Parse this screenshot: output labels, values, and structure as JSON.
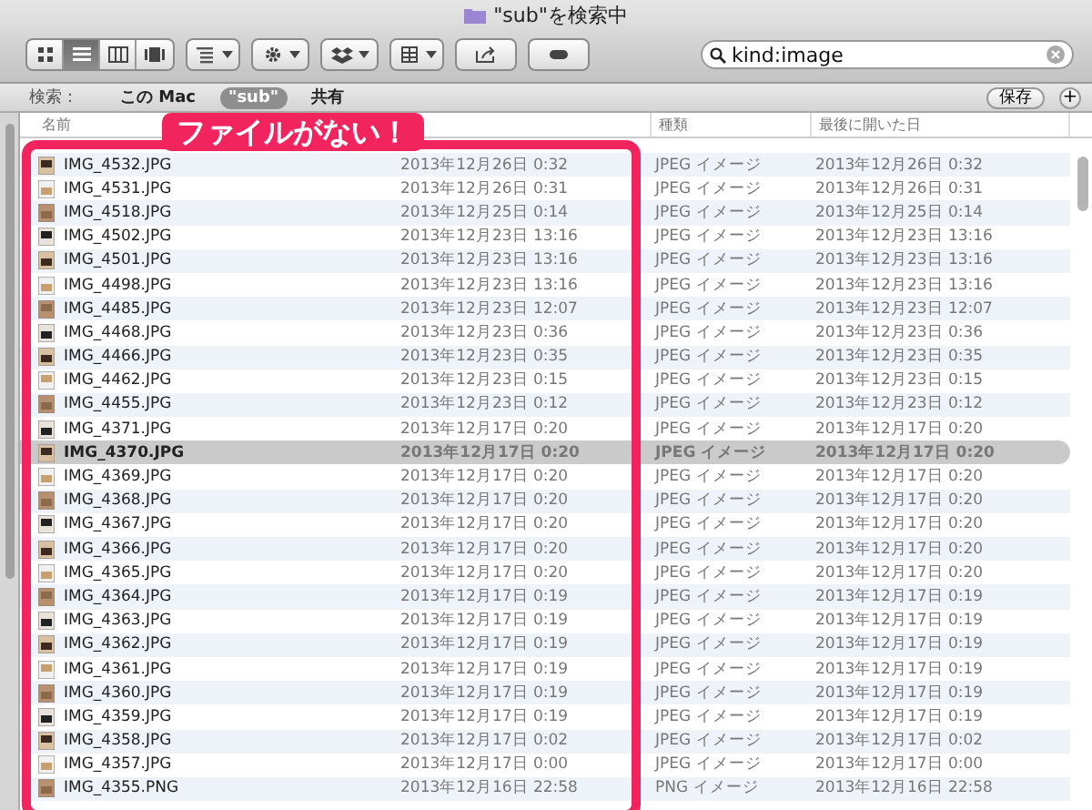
{
  "window": {
    "title": "\"sub\"を検索中"
  },
  "toolbar": {
    "view_modes": [
      {
        "kind": "icons",
        "selected": false
      },
      {
        "kind": "list",
        "selected": true
      },
      {
        "kind": "columns",
        "selected": false
      },
      {
        "kind": "coverflow",
        "selected": false
      }
    ],
    "buttons": [
      {
        "kind": "arrange"
      },
      {
        "kind": "action"
      },
      {
        "kind": "dropbox"
      },
      {
        "kind": "group"
      },
      {
        "kind": "share"
      },
      {
        "kind": "tag"
      }
    ]
  },
  "search": {
    "value": "kind:image"
  },
  "scope_bar": {
    "label": "検索：",
    "scopes": [
      {
        "label": "この Mac",
        "selected": false
      },
      {
        "label": "\"sub\"",
        "selected": true
      },
      {
        "label": "共有",
        "selected": false
      }
    ],
    "save": "保存",
    "add": "+"
  },
  "table": {
    "columns": [
      {
        "label": "名前"
      },
      {
        "label": "種類"
      },
      {
        "label": "最後に開いた日"
      }
    ],
    "rows": [
      {
        "name": "IMG_4532.JPG",
        "date": "2013年12月26日 0:32",
        "kind": "JPEG イメージ",
        "opened": "2013年12月26日 0:32",
        "selected": false
      },
      {
        "name": "IMG_4531.JPG",
        "date": "2013年12月26日 0:31",
        "kind": "JPEG イメージ",
        "opened": "2013年12月26日 0:31",
        "selected": false
      },
      {
        "name": "IMG_4518.JPG",
        "date": "2013年12月25日 0:14",
        "kind": "JPEG イメージ",
        "opened": "2013年12月25日 0:14",
        "selected": false
      },
      {
        "name": "IMG_4502.JPG",
        "date": "2013年12月23日 13:16",
        "kind": "JPEG イメージ",
        "opened": "2013年12月23日 13:16",
        "selected": false
      },
      {
        "name": "IMG_4501.JPG",
        "date": "2013年12月23日 13:16",
        "kind": "JPEG イメージ",
        "opened": "2013年12月23日 13:16",
        "selected": false
      },
      {
        "name": "IMG_4498.JPG",
        "date": "2013年12月23日 13:16",
        "kind": "JPEG イメージ",
        "opened": "2013年12月23日 13:16",
        "selected": false
      },
      {
        "name": "IMG_4485.JPG",
        "date": "2013年12月23日 12:07",
        "kind": "JPEG イメージ",
        "opened": "2013年12月23日 12:07",
        "selected": false
      },
      {
        "name": "IMG_4468.JPG",
        "date": "2013年12月23日 0:36",
        "kind": "JPEG イメージ",
        "opened": "2013年12月23日 0:36",
        "selected": false
      },
      {
        "name": "IMG_4466.JPG",
        "date": "2013年12月23日 0:35",
        "kind": "JPEG イメージ",
        "opened": "2013年12月23日 0:35",
        "selected": false
      },
      {
        "name": "IMG_4462.JPG",
        "date": "2013年12月23日 0:15",
        "kind": "JPEG イメージ",
        "opened": "2013年12月23日 0:15",
        "selected": false
      },
      {
        "name": "IMG_4455.JPG",
        "date": "2013年12月23日 0:12",
        "kind": "JPEG イメージ",
        "opened": "2013年12月23日 0:12",
        "selected": false
      },
      {
        "name": "IMG_4371.JPG",
        "date": "2013年12月17日 0:20",
        "kind": "JPEG イメージ",
        "opened": "2013年12月17日 0:20",
        "selected": false
      },
      {
        "name": "IMG_4370.JPG",
        "date": "2013年12月17日 0:20",
        "kind": "JPEG イメージ",
        "opened": "2013年12月17日 0:20",
        "selected": true
      },
      {
        "name": "IMG_4369.JPG",
        "date": "2013年12月17日 0:20",
        "kind": "JPEG イメージ",
        "opened": "2013年12月17日 0:20",
        "selected": false
      },
      {
        "name": "IMG_4368.JPG",
        "date": "2013年12月17日 0:20",
        "kind": "JPEG イメージ",
        "opened": "2013年12月17日 0:20",
        "selected": false
      },
      {
        "name": "IMG_4367.JPG",
        "date": "2013年12月17日 0:20",
        "kind": "JPEG イメージ",
        "opened": "2013年12月17日 0:20",
        "selected": false
      },
      {
        "name": "IMG_4366.JPG",
        "date": "2013年12月17日 0:20",
        "kind": "JPEG イメージ",
        "opened": "2013年12月17日 0:20",
        "selected": false
      },
      {
        "name": "IMG_4365.JPG",
        "date": "2013年12月17日 0:20",
        "kind": "JPEG イメージ",
        "opened": "2013年12月17日 0:20",
        "selected": false
      },
      {
        "name": "IMG_4364.JPG",
        "date": "2013年12月17日 0:19",
        "kind": "JPEG イメージ",
        "opened": "2013年12月17日 0:19",
        "selected": false
      },
      {
        "name": "IMG_4363.JPG",
        "date": "2013年12月17日 0:19",
        "kind": "JPEG イメージ",
        "opened": "2013年12月17日 0:19",
        "selected": false
      },
      {
        "name": "IMG_4362.JPG",
        "date": "2013年12月17日 0:19",
        "kind": "JPEG イメージ",
        "opened": "2013年12月17日 0:19",
        "selected": false
      },
      {
        "name": "IMG_4361.JPG",
        "date": "2013年12月17日 0:19",
        "kind": "JPEG イメージ",
        "opened": "2013年12月17日 0:19",
        "selected": false
      },
      {
        "name": "IMG_4360.JPG",
        "date": "2013年12月17日 0:19",
        "kind": "JPEG イメージ",
        "opened": "2013年12月17日 0:19",
        "selected": false
      },
      {
        "name": "IMG_4359.JPG",
        "date": "2013年12月17日 0:19",
        "kind": "JPEG イメージ",
        "opened": "2013年12月17日 0:19",
        "selected": false
      },
      {
        "name": "IMG_4358.JPG",
        "date": "2013年12月17日 0:02",
        "kind": "JPEG イメージ",
        "opened": "2013年12月17日 0:02",
        "selected": false
      },
      {
        "name": "IMG_4357.JPG",
        "date": "2013年12月17日 0:00",
        "kind": "JPEG イメージ",
        "opened": "2013年12月17日 0:00",
        "selected": false
      },
      {
        "name": "IMG_4355.PNG",
        "date": "2013年12月16日 22:58",
        "kind": "PNG イメージ",
        "opened": "2013年12月16日 22:58",
        "selected": false
      }
    ]
  },
  "annotation": {
    "text": "ファイルがない！"
  }
}
